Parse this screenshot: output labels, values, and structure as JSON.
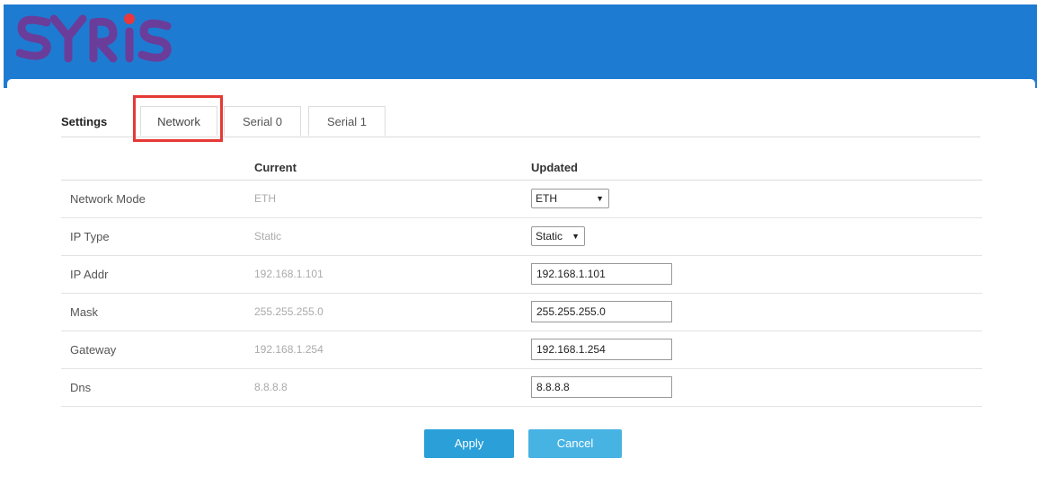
{
  "brand": {
    "logo_text": "SYRIS",
    "header_color": "#1e7bd2",
    "logo_colors": [
      "#6a3d9a",
      "#e8383d"
    ]
  },
  "tabs": {
    "section_label": "Settings",
    "items": [
      {
        "label": "Network",
        "active": true
      },
      {
        "label": "Serial 0",
        "active": false
      },
      {
        "label": "Serial 1",
        "active": false
      }
    ]
  },
  "table": {
    "headers": {
      "current": "Current",
      "updated": "Updated"
    },
    "rows": [
      {
        "label": "Network Mode",
        "current": "ETH",
        "updated": "ETH",
        "control": "select"
      },
      {
        "label": "IP Type",
        "current": "Static",
        "updated": "Static",
        "control": "select"
      },
      {
        "label": "IP Addr",
        "current": "192.168.1.101",
        "updated": "192.168.1.101",
        "control": "input"
      },
      {
        "label": "Mask",
        "current": "255.255.255.0",
        "updated": "255.255.255.0",
        "control": "input"
      },
      {
        "label": "Gateway",
        "current": "192.168.1.254",
        "updated": "192.168.1.254",
        "control": "input"
      },
      {
        "label": "Dns",
        "current": "8.8.8.8",
        "updated": "8.8.8.8",
        "control": "input"
      }
    ]
  },
  "actions": {
    "apply_label": "Apply",
    "cancel_label": "Cancel",
    "apply_color": "#2a9fd8",
    "cancel_color": "#47b3e3"
  },
  "icons": {
    "dropdown": "chevron-down-icon"
  }
}
